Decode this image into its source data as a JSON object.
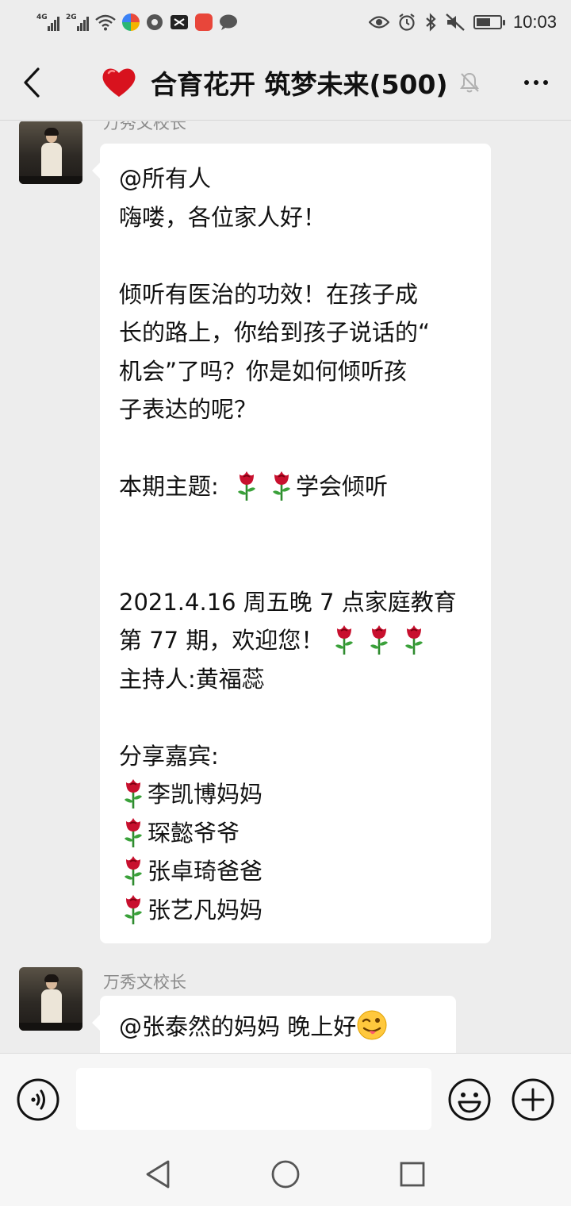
{
  "status_bar": {
    "network_1": "4G",
    "network_2": "2G",
    "time": "10:03",
    "battery_level": 0.6
  },
  "header": {
    "title": "合育花开 筑梦未来(500)",
    "title_emoji_icon": "red-heart-icon",
    "muted": true
  },
  "messages": [
    {
      "sender": "万秀文校长",
      "lines": [
        "@所有人",
        "嗨喽，各位家人好！",
        "",
        "倾听有医治的功效！在孩子成",
        "长的路上，你给到孩子说话的“",
        "机会”了吗？你是如何倾听孩",
        "子表达的呢？",
        "",
        {
          "text": "本期主题: ",
          "roses_after": 2,
          "after": "学会倾听"
        },
        "",
        "",
        "2021.4.16 周五晚 7 点家庭教育",
        {
          "text": "第 77 期，欢迎您！",
          "roses_after": 3,
          "after": ""
        },
        "主持人:黄福蕊",
        "",
        "分享嘉宾:",
        {
          "text": "",
          "roses_after": 1,
          "after": "李凯博妈妈"
        },
        {
          "text": "",
          "roses_after": 1,
          "after": "琛懿爷爷"
        },
        {
          "text": "",
          "roses_after": 1,
          "after": "张卓琦爸爸"
        },
        {
          "text": "",
          "roses_after": 1,
          "after": "张艺凡妈妈"
        }
      ]
    },
    {
      "sender": "万秀文校长",
      "lines": [
        {
          "text": "@张泰然的妈妈  晚上好",
          "emoji": "winking-face-tongue-icon"
        }
      ]
    }
  ],
  "input": {
    "value": "",
    "placeholder": ""
  },
  "colors": {
    "background": "#ededed",
    "bubble": "#ffffff",
    "sender_name": "#8a8a8a",
    "rose": "#c8102e"
  }
}
